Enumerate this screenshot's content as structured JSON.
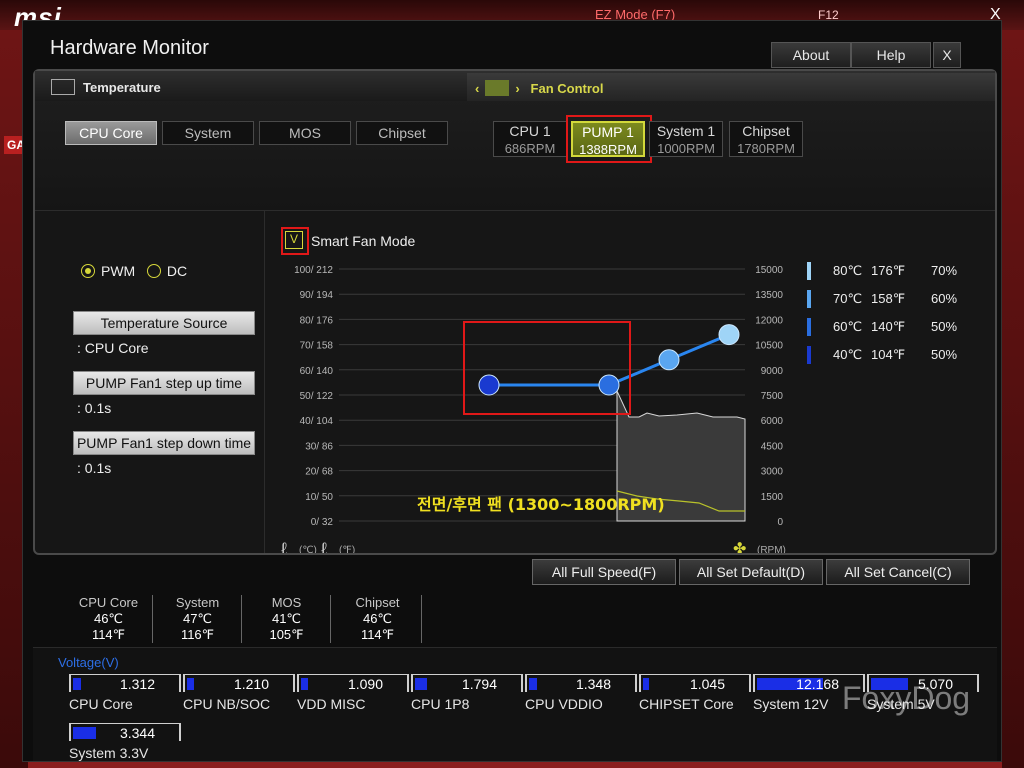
{
  "bios": {
    "ez_mode": "EZ Mode (F7)",
    "f12": "F12",
    "close": "X",
    "side_label": "GA"
  },
  "window": {
    "title": "Hardware Monitor",
    "about": "About",
    "help": "Help",
    "close": "X"
  },
  "temperature": {
    "header": "Temperature",
    "tabs": [
      "CPU Core",
      "System",
      "MOS",
      "Chipset"
    ],
    "active_tab": "CPU Core"
  },
  "fan_control": {
    "header": "Fan Control",
    "fans": [
      {
        "name": "CPU 1",
        "rpm": "686RPM"
      },
      {
        "name": "PUMP 1",
        "rpm": "1388RPM"
      },
      {
        "name": "System 1",
        "rpm": "1000RPM"
      },
      {
        "name": "Chipset",
        "rpm": "1780RPM"
      }
    ],
    "active_fan": "PUMP 1"
  },
  "mode": {
    "pwm": "PWM",
    "dc": "DC",
    "selected": "PWM"
  },
  "settings": {
    "temp_source_label": "Temperature Source",
    "temp_source_value": ": CPU Core",
    "step_up_label": "PUMP Fan1 step up time",
    "step_up_value": ": 0.1s",
    "step_down_label": "PUMP Fan1 step down time",
    "step_down_value": ": 0.1s"
  },
  "smart_fan": {
    "checkbox": "V",
    "label": "Smart Fan Mode",
    "annotation": "전면/후면 팬 (1300~1800RPM)",
    "unit_c": "(℃)",
    "unit_f": "(℉)",
    "unit_rpm": "(RPM)"
  },
  "chart_data": {
    "type": "line",
    "left_axis_ticks": [
      "100/ 212",
      "90/ 194",
      "80/ 176",
      "70/ 158",
      "60/ 140",
      "50/ 122",
      "40/ 104",
      "30/ 86",
      "20/ 68",
      "10/ 50",
      "0/ 32"
    ],
    "right_axis_ticks": [
      "15000",
      "13500",
      "12000",
      "10500",
      "9000",
      "7500",
      "6000",
      "4500",
      "3000",
      "1500",
      "0"
    ],
    "series": [
      {
        "name": "Fan curve",
        "points": [
          [
            40,
            50
          ],
          [
            60,
            50
          ],
          [
            70,
            60
          ],
          [
            80,
            70
          ]
        ]
      }
    ],
    "legend": [
      {
        "c": "80℃",
        "f": "176℉",
        "pct": "70%",
        "color": "#9fd4f7"
      },
      {
        "c": "70℃",
        "f": "158℉",
        "pct": "60%",
        "color": "#5aa6f0"
      },
      {
        "c": "60℃",
        "f": "140℉",
        "pct": "50%",
        "color": "#2a6ee0"
      },
      {
        "c": "40℃",
        "f": "104℉",
        "pct": "50%",
        "color": "#1a3ad0"
      }
    ]
  },
  "actions": {
    "full_speed": "All Full Speed(F)",
    "set_default": "All Set Default(D)",
    "set_cancel": "All Set Cancel(C)"
  },
  "temps": [
    {
      "name": "CPU Core",
      "c": "46℃",
      "f": "114℉"
    },
    {
      "name": "System",
      "c": "47℃",
      "f": "116℉"
    },
    {
      "name": "MOS",
      "c": "41℃",
      "f": "105℉"
    },
    {
      "name": "Chipset",
      "c": "46℃",
      "f": "114℉"
    }
  ],
  "voltage": {
    "title": "Voltage(V)",
    "items": [
      {
        "name": "CPU Core",
        "value": "1.312",
        "fill": 0.08
      },
      {
        "name": "CPU NB/SOC",
        "value": "1.210",
        "fill": 0.07
      },
      {
        "name": "VDD MISC",
        "value": "1.090",
        "fill": 0.07
      },
      {
        "name": "CPU 1P8",
        "value": "1.794",
        "fill": 0.11
      },
      {
        "name": "CPU VDDIO",
        "value": "1.348",
        "fill": 0.08
      },
      {
        "name": "CHIPSET Core",
        "value": "1.045",
        "fill": 0.06
      },
      {
        "name": "System 12V",
        "value": "12.168",
        "fill": 0.62
      },
      {
        "name": "System 5V",
        "value": "5.070",
        "fill": 0.35
      },
      {
        "name": "System 3.3V",
        "value": "3.344",
        "fill": 0.22
      }
    ]
  },
  "watermark": "FoxyDog"
}
